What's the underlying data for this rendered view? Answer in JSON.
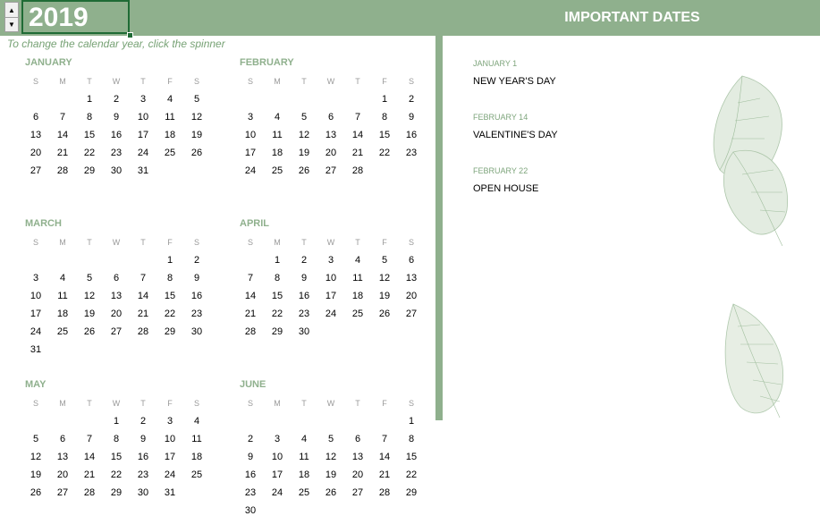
{
  "year": "2019",
  "hint": "To change the calendar year, click the spinner",
  "important_title": "IMPORTANT DATES",
  "dow": [
    "S",
    "M",
    "T",
    "W",
    "T",
    "F",
    "S"
  ],
  "months": [
    {
      "name": "JANUARY",
      "start": 2,
      "days": 31
    },
    {
      "name": "FEBRUARY",
      "start": 5,
      "days": 28
    },
    {
      "name": "MARCH",
      "start": 5,
      "days": 31
    },
    {
      "name": "APRIL",
      "start": 1,
      "days": 30
    },
    {
      "name": "MAY",
      "start": 3,
      "days": 31
    },
    {
      "name": "JUNE",
      "start": 6,
      "days": 30
    }
  ],
  "events": [
    {
      "date": "JANUARY 1",
      "name": "NEW YEAR'S DAY"
    },
    {
      "date": "FEBRUARY 14",
      "name": "VALENTINE'S DAY"
    },
    {
      "date": "FEBRUARY 22",
      "name": "OPEN HOUSE"
    }
  ],
  "colors": {
    "header": "#8fb08d",
    "accent": "#8fb08d",
    "hint": "#77a275"
  },
  "icons": {
    "spin_up": "spinner-up-arrow",
    "spin_down": "spinner-down-arrow"
  }
}
